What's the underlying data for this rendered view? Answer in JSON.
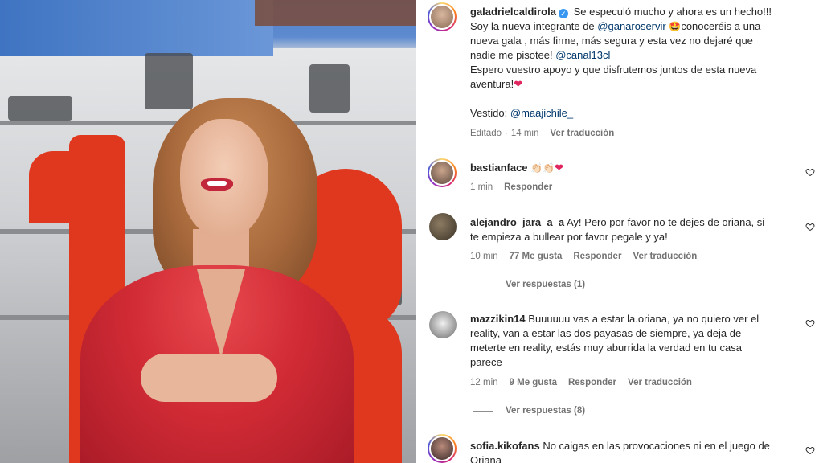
{
  "post": {
    "author": "galadrielcaldirola",
    "caption_line1": "Se especuló mucho y ahora es un hecho!!!",
    "caption_line2_prefix": "Soy la nueva integrante de ",
    "caption_mention1": "@ganaroservir",
    "caption_line2_suffix": "conoceréis a una",
    "caption_line3": "nueva gala , más firme, más segura y esta vez no dejaré que",
    "caption_line4_prefix": "nadie me pisotee! ",
    "caption_mention2": "@canal13cl",
    "caption_line5": "Espero vuestro apoyo y que disfrutemos juntos de esta nueva",
    "caption_line6": "aventura!",
    "dress_prefix": "Vestido: ",
    "dress_mention": "@maajichile_",
    "edited": "Editado",
    "time": "14 min",
    "see_translation": "Ver traducción"
  },
  "comments": [
    {
      "username": "bastianface",
      "text": "",
      "time": "1 min",
      "likes": "",
      "reply_label": "Responder",
      "translate_label": ""
    },
    {
      "username": "alejandro_jara_a_a",
      "text_line1": "Ay! Pero por favor no te dejes de oriana, si",
      "text_line2": "te empieza a bullear por favor pegale y ya!",
      "time": "10 min",
      "likes": "77 Me gusta",
      "reply_label": "Responder",
      "translate_label": "Ver traducción",
      "view_replies": "Ver respuestas (1)"
    },
    {
      "username": "mazzikin14",
      "text_line1": "Buuuuuu vas a estar la.oriana, ya no quiero ver el",
      "text_line2": "reality, van a estar las dos payasas de siempre, ya deja de",
      "text_line3": "meterte en reality, estás muy aburrida la verdad en tu casa",
      "text_line4": "parece",
      "time": "12 min",
      "likes": "9 Me gusta",
      "reply_label": "Responder",
      "translate_label": "Ver traducción",
      "view_replies": "Ver respuestas (8)"
    },
    {
      "username": "sofia.kikofans",
      "text_line1": "No caigas en las provocaciones ni en el juego de",
      "text_line2": "Oriana"
    }
  ],
  "colors": {
    "mention": "#00376b",
    "meta": "#737373",
    "verified": "#3897f0",
    "heart": "#e0245e"
  }
}
